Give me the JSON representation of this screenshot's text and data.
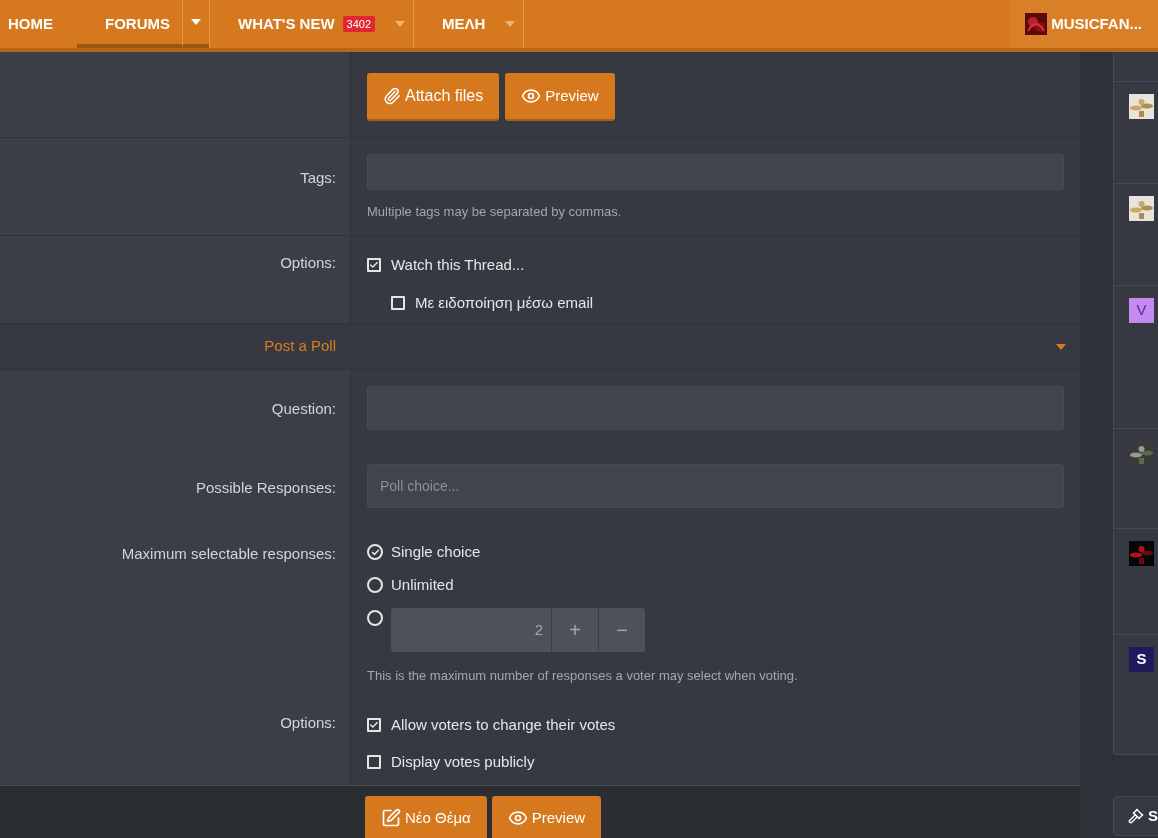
{
  "nav": {
    "items": [
      {
        "label": "HOME",
        "selected": false,
        "has_menu": false
      },
      {
        "label": "FORUMS",
        "selected": true,
        "has_menu": true
      },
      {
        "label": "WHAT'S NEW",
        "selected": false,
        "has_menu": true,
        "badge": "3402"
      },
      {
        "label": "ΜΕΛΗ",
        "selected": false,
        "has_menu": true
      }
    ],
    "user": {
      "name": "MUSICFAN..."
    }
  },
  "form": {
    "attach_button": "Attach files",
    "preview_button": "Preview",
    "tags": {
      "label": "Tags:",
      "hint": "Multiple tags may be separated by commas."
    },
    "options": {
      "label": "Options:",
      "items": [
        {
          "label": "Watch this Thread...",
          "checked": true,
          "children": [
            {
              "label": "Με ειδοποίηση μέσω email",
              "checked": false
            }
          ]
        }
      ]
    },
    "poll": {
      "title": "Post a Poll",
      "expanded": true,
      "question": {
        "label": "Question:"
      },
      "responses": {
        "label": "Possible Responses:",
        "placeholder": "Poll choice..."
      },
      "max": {
        "label": "Maximum selectable responses:",
        "choices": [
          {
            "kind": "text",
            "label": "Single choice",
            "selected": true
          },
          {
            "kind": "text",
            "label": "Unlimited",
            "selected": false
          },
          {
            "kind": "number",
            "value": "2",
            "plus": "+",
            "minus": "−",
            "selected": false
          }
        ],
        "hint": "This is the maximum number of responses a voter may select when voting."
      },
      "options": {
        "label": "Options:",
        "items": [
          {
            "label": "Allow voters to change their votes",
            "checked": true
          },
          {
            "label": "Display votes publicly",
            "checked": false
          }
        ]
      }
    }
  },
  "sidebar": {
    "avatars": [
      {
        "kind": "picture"
      },
      {
        "kind": "picture"
      },
      {
        "kind": "letter",
        "letter": "V",
        "color": "#c58af0"
      },
      {
        "kind": "picture"
      },
      {
        "kind": "picture"
      },
      {
        "kind": "letter",
        "letter": "S",
        "color": "#1e1a5c"
      }
    ],
    "tool_button": "S"
  },
  "footer": {
    "submit_button": "Νέο Θέμα",
    "preview_button": "Preview"
  }
}
